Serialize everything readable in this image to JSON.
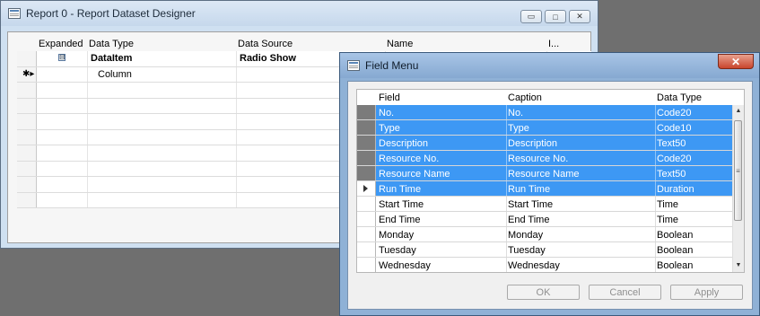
{
  "win1": {
    "title": "Report 0 - Report Dataset Designer",
    "controls": {
      "minimize": "▭",
      "maximize": "□",
      "close": "✕"
    },
    "grid": {
      "headers": [
        "Expanded",
        "Data Type",
        "Data Source",
        "Name",
        "I..."
      ],
      "rows": [
        {
          "expanded": "⊟",
          "data_type": "DataItem",
          "data_source": "Radio Show"
        },
        {
          "marker": "✱▸",
          "data_type": "Column",
          "data_source": ""
        }
      ]
    }
  },
  "win2": {
    "title": "Field Menu",
    "close_label": "✕",
    "headers": [
      "Field",
      "Caption",
      "Data Type"
    ],
    "rows": [
      {
        "field": "No.",
        "caption": "No.",
        "type": "Code20",
        "selected": true,
        "current": false
      },
      {
        "field": "Type",
        "caption": "Type",
        "type": "Code10",
        "selected": true,
        "current": false
      },
      {
        "field": "Description",
        "caption": "Description",
        "type": "Text50",
        "selected": true,
        "current": false
      },
      {
        "field": "Resource No.",
        "caption": "Resource No.",
        "type": "Code20",
        "selected": true,
        "current": false
      },
      {
        "field": "Resource Name",
        "caption": "Resource Name",
        "type": "Text50",
        "selected": true,
        "current": false
      },
      {
        "field": "Run Time",
        "caption": "Run Time",
        "type": "Duration",
        "selected": true,
        "current": true
      },
      {
        "field": "Start Time",
        "caption": "Start Time",
        "type": "Time",
        "selected": false,
        "current": false
      },
      {
        "field": "End Time",
        "caption": "End Time",
        "type": "Time",
        "selected": false,
        "current": false
      },
      {
        "field": "Monday",
        "caption": "Monday",
        "type": "Boolean",
        "selected": false,
        "current": false
      },
      {
        "field": "Tuesday",
        "caption": "Tuesday",
        "type": "Boolean",
        "selected": false,
        "current": false
      },
      {
        "field": "Wednesday",
        "caption": "Wednesday",
        "type": "Boolean",
        "selected": false,
        "current": false
      }
    ],
    "scroll": {
      "up": "▲",
      "down": "▼",
      "grip": "≡"
    },
    "buttons": {
      "ok": "OK",
      "cancel": "Cancel",
      "apply": "Apply"
    }
  }
}
